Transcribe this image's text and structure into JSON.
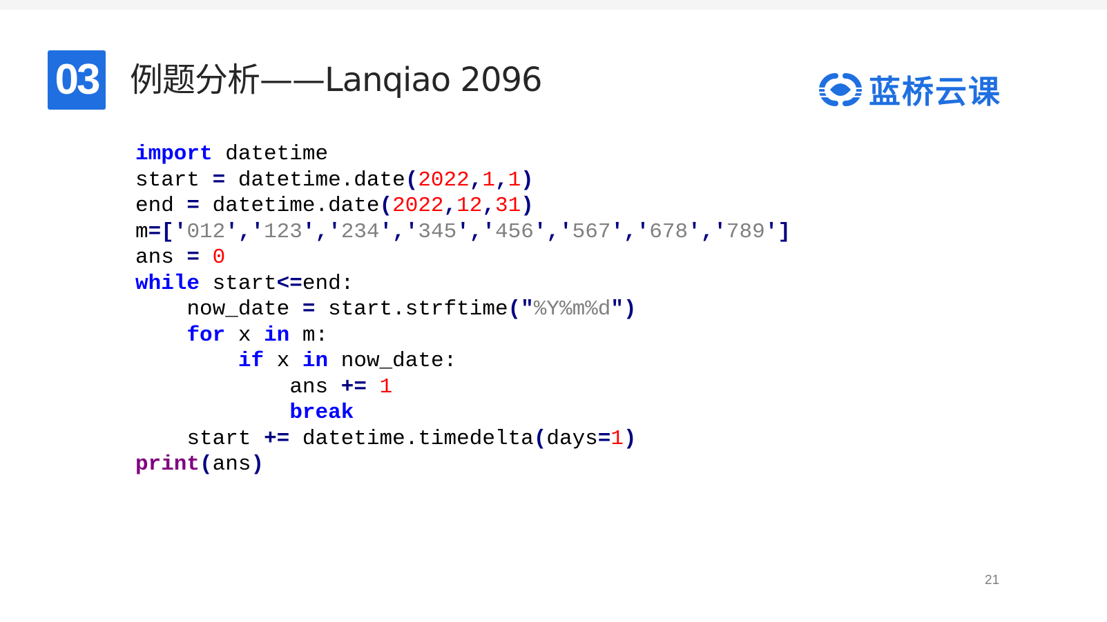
{
  "slide": {
    "section_number": "03",
    "title": "例题分析——Lanqiao 2096",
    "logo_text": "蓝桥云课",
    "page_number": "21"
  },
  "colors": {
    "accent": "#1f6fe0",
    "keyword": "#0000ff",
    "operator": "#000080",
    "number": "#ff0000",
    "string": "#808080",
    "builtin": "#800080"
  },
  "icons": {
    "logo": "lanqiao-logo-icon"
  },
  "code": {
    "language": "python",
    "lines": [
      "import datetime",
      "start = datetime.date(2022,1,1)",
      "end = datetime.date(2022,12,31)",
      "m=['012','123','234','345','456','567','678','789']",
      "ans = 0",
      "while start<=end:",
      "    now_date = start.strftime(\"%Y%m%d\")",
      "    for x in m:",
      "        if x in now_date:",
      "            ans += 1",
      "            break",
      "    start += datetime.timedelta(days=1)",
      "print(ans)"
    ]
  }
}
